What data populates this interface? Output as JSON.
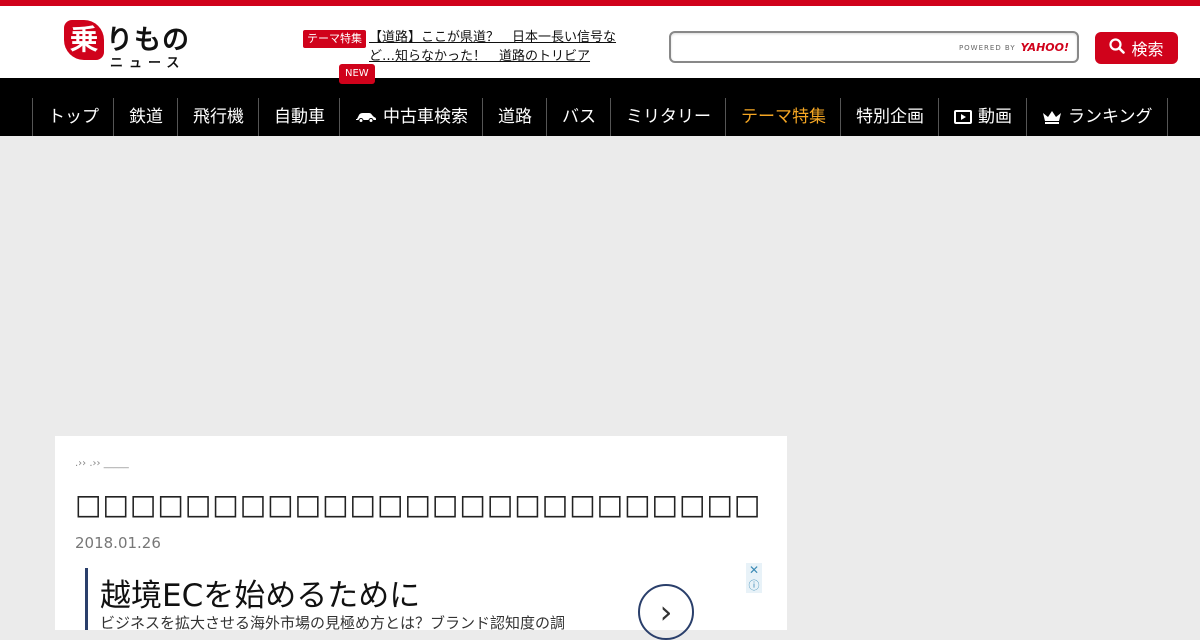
{
  "header": {
    "logo": {
      "mark": "乗",
      "main": "りもの",
      "sub": "ニュース"
    },
    "feature_badge": "テーマ特集",
    "feature_link": "【道路】ここが県道？　日本一長い信号など…知らなかった！　道路のトリビア",
    "new_badge": "NEW",
    "search": {
      "value": "",
      "placeholder": "",
      "powered_by": "POWERED BY",
      "powered_brand": "YAHOO!"
    },
    "search_button": "検索"
  },
  "nav": [
    {
      "label": "トップ",
      "icon": null
    },
    {
      "label": "鉄道",
      "icon": null
    },
    {
      "label": "飛行機",
      "icon": null
    },
    {
      "label": "自動車",
      "icon": null
    },
    {
      "label": "中古車検索",
      "icon": "car-icon"
    },
    {
      "label": "道路",
      "icon": null
    },
    {
      "label": "バス",
      "icon": null
    },
    {
      "label": "ミリタリー",
      "icon": null
    },
    {
      "label": "テーマ特集",
      "icon": null,
      "active": true
    },
    {
      "label": "特別企画",
      "icon": null
    },
    {
      "label": "動画",
      "icon": "video-icon"
    },
    {
      "label": "ランキング",
      "icon": "crown-icon"
    }
  ],
  "article": {
    "breadcrumb": ".›› .›› _____",
    "title": "□□□□□□□□□□□□□□□□□□□□□□□□□",
    "date": "2018.01.26"
  },
  "ad": {
    "headline": "越境ECを始めるために",
    "description": "ビジネスを拡大させる海外市場の見極め方とは？ブランド認知度の調",
    "close": "✕",
    "info": "ⓘ"
  },
  "colors": {
    "brand": "#d0021b",
    "nav_bg": "#000000",
    "nav_active": "#f5a623"
  }
}
